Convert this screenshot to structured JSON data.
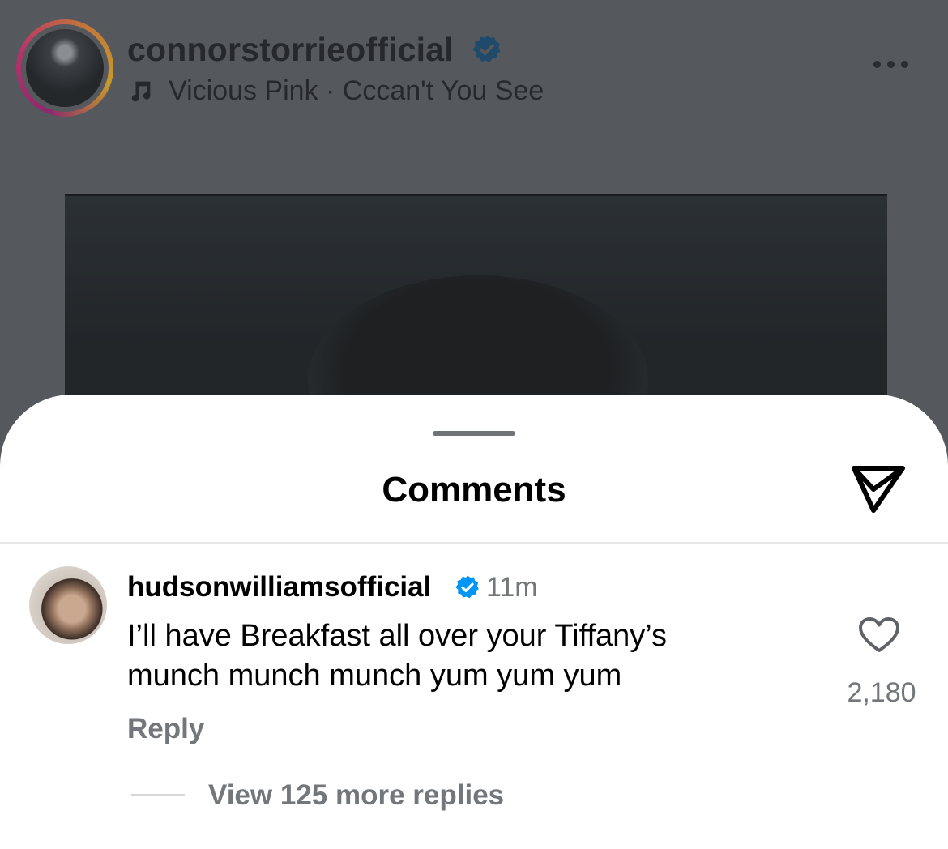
{
  "post": {
    "username": "connorstorrieofficial",
    "music": "Vicious Pink · Cccan't You See",
    "icons": {
      "avatar": "profile-avatar",
      "verified": "verified-badge-icon",
      "music": "music-note-icon",
      "more": "more-options-icon"
    }
  },
  "comments_sheet": {
    "title": "Comments",
    "share_icon": "send-icon",
    "comment": {
      "username": "hudsonwilliamsofficial",
      "time": "11m",
      "text_line1": "I’ll have Breakfast all over your Tiffany’s",
      "text_line2": "munch munch munch yum yum yum",
      "reply_label": "Reply",
      "like_count": "2,180",
      "view_replies": "View 125 more replies"
    }
  },
  "colors": {
    "verified_blue": "#0095f6",
    "muted_text": "#73767a",
    "overlay": "#55585c"
  }
}
